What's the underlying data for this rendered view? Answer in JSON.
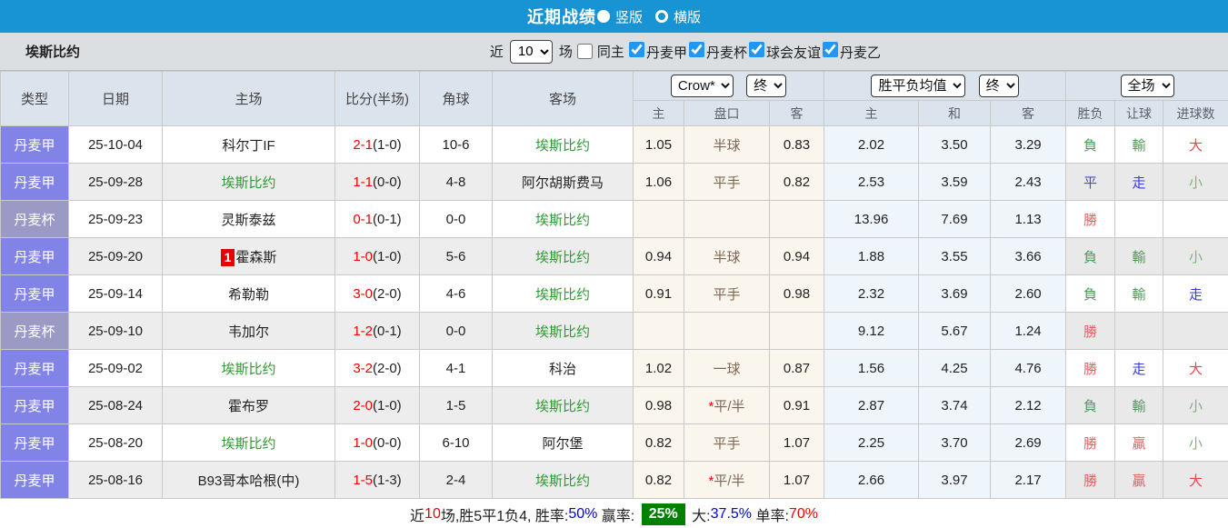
{
  "title_bar": {
    "title": "近期战绩",
    "radio_vertical": "竖版",
    "radio_horizontal": "横版"
  },
  "filter_bar": {
    "team": "埃斯比约",
    "recent_label": "近",
    "recent_value": "10",
    "games_label": "场",
    "same_home_label": "同主",
    "leagues": [
      "丹麦甲",
      "丹麦杯",
      "球会友谊",
      "丹麦乙"
    ]
  },
  "table": {
    "main_headers": [
      "类型",
      "日期",
      "主场",
      "比分(半场)",
      "角球",
      "客场"
    ],
    "odds_dropdown": "Crow*",
    "odds_stage_dropdown": "终",
    "avg_dropdown": "胜平负均值",
    "avg_stage_dropdown": "终",
    "scope_dropdown": "全场",
    "sub_headers": [
      "主",
      "盘口",
      "客",
      "主",
      "和",
      "客",
      "胜负",
      "让球",
      "进球数"
    ],
    "rows": [
      {
        "type": "丹麦甲",
        "type_class": "league-jia",
        "date": "25-10-04",
        "home": {
          "badge": "",
          "name": "科尔丁IF",
          "is_focus": false
        },
        "score": {
          "ft": "2-1",
          "ht": "(1-0)"
        },
        "corner": "10-6",
        "away": {
          "name": "埃斯比约",
          "is_focus": true
        },
        "odds": {
          "home": "1.05",
          "handicap": "半球",
          "star": false,
          "away": "0.83"
        },
        "avg": {
          "home": "2.02",
          "draw": "3.50",
          "away": "3.29"
        },
        "result": {
          "text": "負",
          "cls": "c-lose"
        },
        "handicap_result": {
          "text": "輸",
          "cls": "c-lose"
        },
        "goals": {
          "text": "大",
          "cls": "c-big"
        }
      },
      {
        "type": "丹麦甲",
        "type_class": "league-jia",
        "date": "25-09-28",
        "home": {
          "badge": "",
          "name": "埃斯比约",
          "is_focus": true
        },
        "score": {
          "ft": "1-1",
          "ht": "(0-0)"
        },
        "corner": "4-8",
        "away": {
          "name": "阿尔胡斯费马",
          "is_focus": false
        },
        "odds": {
          "home": "1.06",
          "handicap": "平手",
          "star": false,
          "away": "0.82"
        },
        "avg": {
          "home": "2.53",
          "draw": "3.59",
          "away": "2.43"
        },
        "result": {
          "text": "平",
          "cls": "c-draw"
        },
        "handicap_result": {
          "text": "走",
          "cls": "c-go"
        },
        "goals": {
          "text": "小",
          "cls": "c-small"
        }
      },
      {
        "type": "丹麦杯",
        "type_class": "league-cup",
        "date": "25-09-23",
        "home": {
          "badge": "",
          "name": "灵斯泰兹",
          "is_focus": false
        },
        "score": {
          "ft": "0-1",
          "ht": "(0-1)"
        },
        "corner": "0-0",
        "away": {
          "name": "埃斯比约",
          "is_focus": true
        },
        "odds": {
          "home": "",
          "handicap": "",
          "star": false,
          "away": ""
        },
        "avg": {
          "home": "13.96",
          "draw": "7.69",
          "away": "1.13"
        },
        "result": {
          "text": "勝",
          "cls": "c-win"
        },
        "handicap_result": {
          "text": "",
          "cls": ""
        },
        "goals": {
          "text": "",
          "cls": ""
        }
      },
      {
        "type": "丹麦甲",
        "type_class": "league-jia",
        "date": "25-09-20",
        "home": {
          "badge": "1",
          "name": "霍森斯",
          "is_focus": false
        },
        "score": {
          "ft": "1-0",
          "ht": "(1-0)"
        },
        "corner": "5-6",
        "away": {
          "name": "埃斯比约",
          "is_focus": true
        },
        "odds": {
          "home": "0.94",
          "handicap": "半球",
          "star": false,
          "away": "0.94"
        },
        "avg": {
          "home": "1.88",
          "draw": "3.55",
          "away": "3.66"
        },
        "result": {
          "text": "負",
          "cls": "c-lose"
        },
        "handicap_result": {
          "text": "輸",
          "cls": "c-lose"
        },
        "goals": {
          "text": "小",
          "cls": "c-small"
        }
      },
      {
        "type": "丹麦甲",
        "type_class": "league-jia",
        "date": "25-09-14",
        "home": {
          "badge": "",
          "name": "希勒勒",
          "is_focus": false
        },
        "score": {
          "ft": "3-0",
          "ht": "(2-0)"
        },
        "corner": "4-6",
        "away": {
          "name": "埃斯比约",
          "is_focus": true
        },
        "odds": {
          "home": "0.91",
          "handicap": "平手",
          "star": false,
          "away": "0.98"
        },
        "avg": {
          "home": "2.32",
          "draw": "3.69",
          "away": "2.60"
        },
        "result": {
          "text": "負",
          "cls": "c-lose"
        },
        "handicap_result": {
          "text": "輸",
          "cls": "c-lose"
        },
        "goals": {
          "text": "走",
          "cls": "c-go"
        }
      },
      {
        "type": "丹麦杯",
        "type_class": "league-cup",
        "date": "25-09-10",
        "home": {
          "badge": "",
          "name": "韦加尔",
          "is_focus": false
        },
        "score": {
          "ft": "1-2",
          "ht": "(0-1)"
        },
        "corner": "0-0",
        "away": {
          "name": "埃斯比约",
          "is_focus": true
        },
        "odds": {
          "home": "",
          "handicap": "",
          "star": false,
          "away": ""
        },
        "avg": {
          "home": "9.12",
          "draw": "5.67",
          "away": "1.24"
        },
        "result": {
          "text": "勝",
          "cls": "c-win"
        },
        "handicap_result": {
          "text": "",
          "cls": ""
        },
        "goals": {
          "text": "",
          "cls": ""
        }
      },
      {
        "type": "丹麦甲",
        "type_class": "league-jia",
        "date": "25-09-02",
        "home": {
          "badge": "",
          "name": "埃斯比约",
          "is_focus": true
        },
        "score": {
          "ft": "3-2",
          "ht": "(2-0)"
        },
        "corner": "4-1",
        "away": {
          "name": "科治",
          "is_focus": false
        },
        "odds": {
          "home": "1.02",
          "handicap": "一球",
          "star": false,
          "away": "0.87"
        },
        "avg": {
          "home": "1.56",
          "draw": "4.25",
          "away": "4.76"
        },
        "result": {
          "text": "勝",
          "cls": "c-win"
        },
        "handicap_result": {
          "text": "走",
          "cls": "c-go"
        },
        "goals": {
          "text": "大",
          "cls": "c-big"
        }
      },
      {
        "type": "丹麦甲",
        "type_class": "league-jia",
        "date": "25-08-24",
        "home": {
          "badge": "",
          "name": "霍布罗",
          "is_focus": false
        },
        "score": {
          "ft": "2-0",
          "ht": "(1-0)"
        },
        "corner": "1-5",
        "away": {
          "name": "埃斯比约",
          "is_focus": true
        },
        "odds": {
          "home": "0.98",
          "handicap": "平/半",
          "star": true,
          "away": "0.91"
        },
        "avg": {
          "home": "2.87",
          "draw": "3.74",
          "away": "2.12"
        },
        "result": {
          "text": "負",
          "cls": "c-lose"
        },
        "handicap_result": {
          "text": "輸",
          "cls": "c-lose"
        },
        "goals": {
          "text": "小",
          "cls": "c-small"
        }
      },
      {
        "type": "丹麦甲",
        "type_class": "league-jia",
        "date": "25-08-20",
        "home": {
          "badge": "",
          "name": "埃斯比约",
          "is_focus": true
        },
        "score": {
          "ft": "1-0",
          "ht": "(0-0)"
        },
        "corner": "6-10",
        "away": {
          "name": "阿尔堡",
          "is_focus": false
        },
        "odds": {
          "home": "0.82",
          "handicap": "平手",
          "star": false,
          "away": "1.07"
        },
        "avg": {
          "home": "2.25",
          "draw": "3.70",
          "away": "2.69"
        },
        "result": {
          "text": "勝",
          "cls": "c-win"
        },
        "handicap_result": {
          "text": "贏",
          "cls": "c-win"
        },
        "goals": {
          "text": "小",
          "cls": "c-small"
        }
      },
      {
        "type": "丹麦甲",
        "type_class": "league-jia",
        "date": "25-08-16",
        "home": {
          "badge": "",
          "name": "B93哥本哈根(中)",
          "is_focus": false
        },
        "score": {
          "ft": "1-5",
          "ht": "(1-3)"
        },
        "corner": "2-4",
        "away": {
          "name": "埃斯比约",
          "is_focus": true
        },
        "odds": {
          "home": "0.82",
          "handicap": "平/半",
          "star": true,
          "away": "1.07"
        },
        "avg": {
          "home": "2.66",
          "draw": "3.97",
          "away": "2.17"
        },
        "result": {
          "text": "勝",
          "cls": "c-win"
        },
        "handicap_result": {
          "text": "贏",
          "cls": "c-win"
        },
        "goals": {
          "text": "大",
          "cls": "c-big"
        }
      }
    ]
  },
  "summary": {
    "segments": [
      {
        "text": "近",
        "cls": "c-dark"
      },
      {
        "text": "10",
        "cls": "c-red"
      },
      {
        "text": "场,胜5平1负4, 胜率:",
        "cls": "c-dark"
      },
      {
        "text": "50%",
        "cls": "c-blue"
      },
      {
        "text": " 赢率: ",
        "cls": "c-dark"
      },
      {
        "text": "25%",
        "cls": "badge-green"
      },
      {
        "text": " 大:",
        "cls": "c-dark"
      },
      {
        "text": "37.5%",
        "cls": "c-blue"
      },
      {
        "text": " 单率:",
        "cls": "c-dark"
      },
      {
        "text": "70%",
        "cls": "c-red"
      }
    ]
  },
  "colors": {
    "title_bar": "#1893d3",
    "league_jia": "#8184e6",
    "league_cup": "#9b9ac4",
    "focus_team_green": "#2f9933",
    "score_red": "#f50000",
    "odds_col_beige": "#faf5ed",
    "avg_col_blue": "#eef5fb",
    "summary_badge_green": "#008000",
    "checkbox_blue": "#2196f3"
  }
}
